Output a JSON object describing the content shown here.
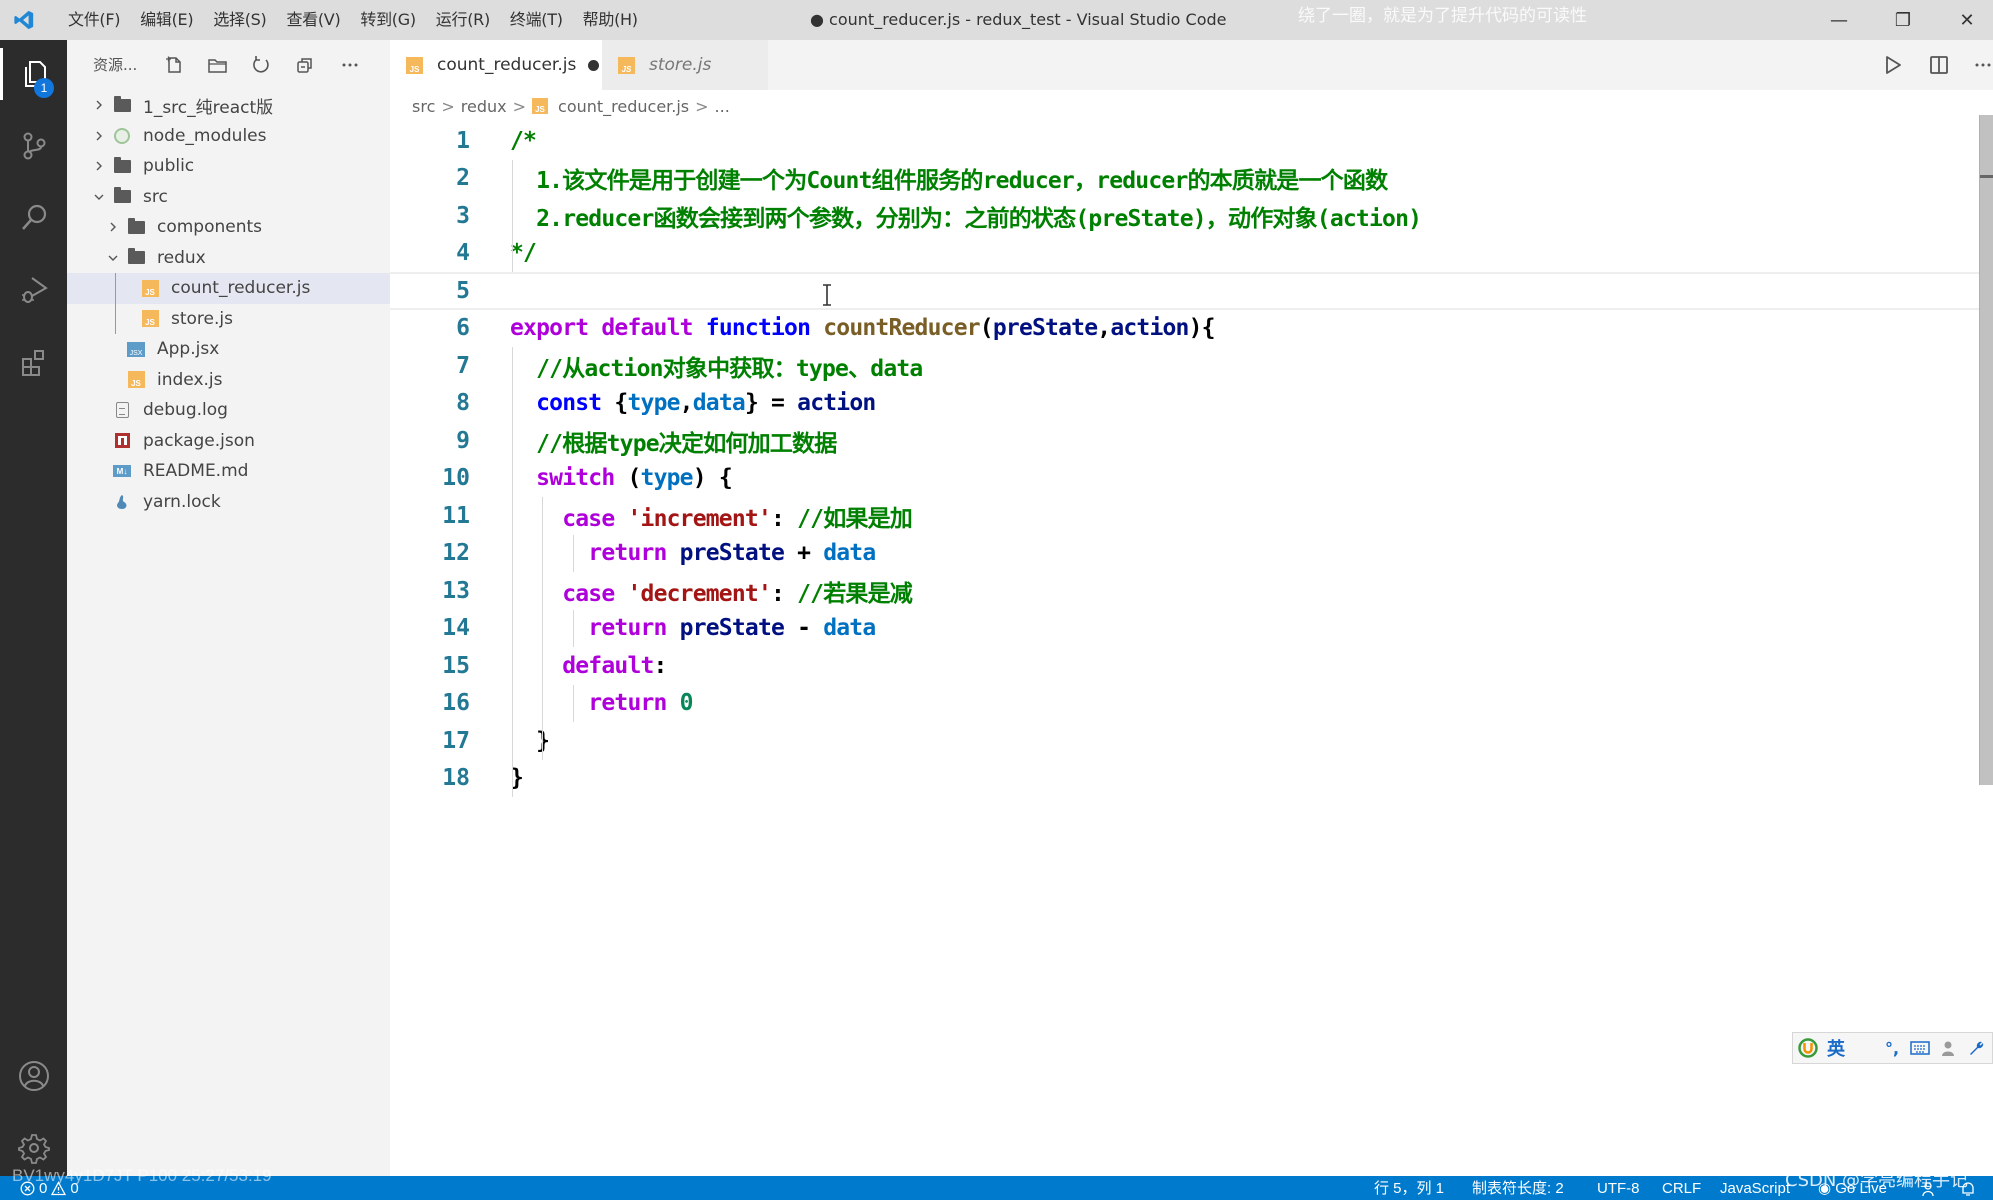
{
  "titlebar": {
    "menu": [
      "文件(F)",
      "编辑(E)",
      "选择(S)",
      "查看(V)",
      "转到(G)",
      "运行(R)",
      "终端(T)",
      "帮助(H)"
    ],
    "title": "● count_reducer.js - redux_test - Visual Studio Code",
    "overlay_subtitle": "绕了一圈，就是为了提升代码的可读性",
    "controls": {
      "minimize": "—",
      "restore": "❐",
      "close": "✕"
    }
  },
  "activitybar": {
    "items": [
      {
        "name": "explorer",
        "badge": "1"
      },
      {
        "name": "source-control"
      },
      {
        "name": "search"
      },
      {
        "name": "run-and-debug"
      },
      {
        "name": "extensions"
      }
    ],
    "bottom": [
      {
        "name": "accounts"
      },
      {
        "name": "manage"
      }
    ]
  },
  "sidebar": {
    "title": "资源...",
    "actions": [
      "new-file",
      "new-folder",
      "refresh",
      "collapse-all",
      "more"
    ],
    "tree": [
      {
        "label": "1_src_纯react版",
        "type": "folder",
        "expanded": false,
        "depth": 0
      },
      {
        "label": "node_modules",
        "type": "node",
        "expanded": false,
        "depth": 0
      },
      {
        "label": "public",
        "type": "folder",
        "expanded": false,
        "depth": 0
      },
      {
        "label": "src",
        "type": "folder",
        "expanded": true,
        "depth": 0
      },
      {
        "label": "components",
        "type": "folder",
        "expanded": false,
        "depth": 1
      },
      {
        "label": "redux",
        "type": "folder",
        "expanded": true,
        "depth": 1
      },
      {
        "label": "count_reducer.js",
        "type": "js",
        "depth": 2,
        "selected": true
      },
      {
        "label": "store.js",
        "type": "js",
        "depth": 2
      },
      {
        "label": "App.jsx",
        "type": "jsx",
        "depth": 1
      },
      {
        "label": "index.js",
        "type": "js",
        "depth": 1
      },
      {
        "label": "debug.log",
        "type": "log",
        "depth": 0
      },
      {
        "label": "package.json",
        "type": "npm",
        "depth": 0
      },
      {
        "label": "README.md",
        "type": "md",
        "depth": 0
      },
      {
        "label": "yarn.lock",
        "type": "yarn",
        "depth": 0
      }
    ]
  },
  "editor": {
    "tabs": [
      {
        "label": "count_reducer.js",
        "active": true,
        "dirty": true
      },
      {
        "label": "store.js",
        "active": false,
        "preview": true
      }
    ],
    "breadcrumb": [
      "src",
      "redux",
      "count_reducer.js",
      "..."
    ],
    "current_line": 5,
    "lines": [
      [
        {
          "t": "/*",
          "c": "cm"
        }
      ],
      [
        {
          "t": "  1.该文件是用于创建一个为Count组件服务的reducer，reducer的本质就是一个函数",
          "c": "cm"
        }
      ],
      [
        {
          "t": "  2.reducer函数会接到两个参数，分别为：之前的状态(preState)，动作对象(action)",
          "c": "cm"
        }
      ],
      [
        {
          "t": "*/",
          "c": "cm"
        }
      ],
      [],
      [
        {
          "t": "export",
          "c": "kw"
        },
        {
          "t": " ",
          "c": "plain"
        },
        {
          "t": "default",
          "c": "kw"
        },
        {
          "t": " ",
          "c": "plain"
        },
        {
          "t": "function",
          "c": "decl"
        },
        {
          "t": " ",
          "c": "plain"
        },
        {
          "t": "countReducer",
          "c": "fn"
        },
        {
          "t": "(",
          "c": "plain"
        },
        {
          "t": "preState",
          "c": "var"
        },
        {
          "t": ",",
          "c": "plain"
        },
        {
          "t": "action",
          "c": "var"
        },
        {
          "t": "){",
          "c": "plain"
        }
      ],
      [
        {
          "t": "  ",
          "c": "plain"
        },
        {
          "t": "//从action对象中获取：type、data",
          "c": "cm"
        }
      ],
      [
        {
          "t": "  ",
          "c": "plain"
        },
        {
          "t": "const",
          "c": "decl"
        },
        {
          "t": " {",
          "c": "plain"
        },
        {
          "t": "type",
          "c": "prop"
        },
        {
          "t": ",",
          "c": "plain"
        },
        {
          "t": "data",
          "c": "prop"
        },
        {
          "t": "} = ",
          "c": "plain"
        },
        {
          "t": "action",
          "c": "var"
        }
      ],
      [
        {
          "t": "  ",
          "c": "plain"
        },
        {
          "t": "//根据type决定如何加工数据",
          "c": "cm"
        }
      ],
      [
        {
          "t": "  ",
          "c": "plain"
        },
        {
          "t": "switch",
          "c": "kw"
        },
        {
          "t": " (",
          "c": "plain"
        },
        {
          "t": "type",
          "c": "prop"
        },
        {
          "t": ") {",
          "c": "plain"
        }
      ],
      [
        {
          "t": "    ",
          "c": "plain"
        },
        {
          "t": "case",
          "c": "kw"
        },
        {
          "t": " ",
          "c": "plain"
        },
        {
          "t": "'increment'",
          "c": "str"
        },
        {
          "t": ": ",
          "c": "plain"
        },
        {
          "t": "//如果是加",
          "c": "cm"
        }
      ],
      [
        {
          "t": "      ",
          "c": "plain"
        },
        {
          "t": "return",
          "c": "kw"
        },
        {
          "t": " ",
          "c": "plain"
        },
        {
          "t": "preState",
          "c": "var"
        },
        {
          "t": " + ",
          "c": "plain"
        },
        {
          "t": "data",
          "c": "prop"
        }
      ],
      [
        {
          "t": "    ",
          "c": "plain"
        },
        {
          "t": "case",
          "c": "kw"
        },
        {
          "t": " ",
          "c": "plain"
        },
        {
          "t": "'decrement'",
          "c": "str"
        },
        {
          "t": ": ",
          "c": "plain"
        },
        {
          "t": "//若果是减",
          "c": "cm"
        }
      ],
      [
        {
          "t": "      ",
          "c": "plain"
        },
        {
          "t": "return",
          "c": "kw"
        },
        {
          "t": " ",
          "c": "plain"
        },
        {
          "t": "preState",
          "c": "var"
        },
        {
          "t": " - ",
          "c": "plain"
        },
        {
          "t": "data",
          "c": "prop"
        }
      ],
      [
        {
          "t": "    ",
          "c": "plain"
        },
        {
          "t": "default",
          "c": "kw"
        },
        {
          "t": ":",
          "c": "plain"
        }
      ],
      [
        {
          "t": "      ",
          "c": "plain"
        },
        {
          "t": "return",
          "c": "kw"
        },
        {
          "t": " ",
          "c": "plain"
        },
        {
          "t": "0",
          "c": "num"
        }
      ],
      [
        {
          "t": "  }",
          "c": "plain"
        }
      ],
      [
        {
          "t": "}",
          "c": "plain"
        }
      ]
    ]
  },
  "ime_toolbar": {
    "items": [
      "ime-logo",
      "英",
      "half-moon",
      "punct",
      "keyboard",
      "user",
      "wrench"
    ]
  },
  "statusbar": {
    "errors": "0",
    "warnings": "0",
    "position": "行 5，列 1",
    "tab_size": "制表符长度: 2",
    "encoding": "UTF-8",
    "eol": "CRLF",
    "language": "JavaScript",
    "go_live": "Go Live"
  },
  "watermarks": {
    "bilibili": "BV1wy4y1D7JT P100 25:27/53:19",
    "csdn": "CSDN @学亮编程手记"
  },
  "colors": {
    "statusbar": "#007acc",
    "activitybar": "#2c2c2c",
    "sidebar": "#f3f3f3",
    "titlebar": "#dddddd",
    "badge": "#1177dd",
    "line_number": "#237893"
  }
}
